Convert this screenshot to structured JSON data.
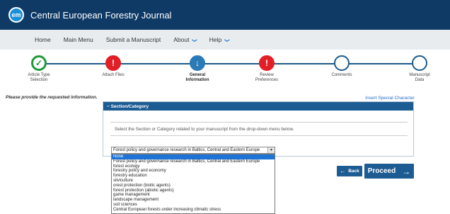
{
  "header": {
    "logo_text": "em",
    "journal_title": "Central European Forestry Journal"
  },
  "nav": {
    "home": "Home",
    "main_menu": "Main Menu",
    "submit": "Submit a Manuscript",
    "about": "About",
    "help": "Help",
    "caret": "❯"
  },
  "steps": [
    {
      "label": "Article Type Selection",
      "status": "complete",
      "icon": "check-icon",
      "symbol": "✓"
    },
    {
      "label": "Attach Files",
      "status": "error",
      "icon": "exclamation-icon",
      "symbol": "!"
    },
    {
      "label": "General Information",
      "status": "current",
      "icon": "arrow-down-icon",
      "symbol": "↓"
    },
    {
      "label": "Review Preferences",
      "status": "error",
      "icon": "exclamation-icon",
      "symbol": "!"
    },
    {
      "label": "Comments",
      "status": "pending",
      "icon": "empty-circle-icon",
      "symbol": ""
    },
    {
      "label": "Manuscript Data",
      "status": "pending",
      "icon": "empty-circle-icon",
      "symbol": ""
    }
  ],
  "content": {
    "instructions": "Please provide the requested information.",
    "special_char_link": "Insert Special Character",
    "panel_title": "− Section/Category",
    "panel_instruction": "Select the Section or Category related to your manuscript from the drop-down menu below.",
    "selected_value": "Forest policy and governance research in Baltics, Central and Eastern Europe",
    "options": [
      "None",
      "Forest policy and governance research in Baltics, Central and Eastern Europe",
      "forest ecology",
      "forestry policy and economy",
      "forestry education",
      "silviculture",
      "orest protection (biotic agents)",
      "forest protection (abiotic agents)",
      "game management",
      "landscape management",
      "soil sciences",
      "Central European forests under increasing climatic stress"
    ],
    "highlighted_option_index": 0,
    "back_label": "Back",
    "proceed_label": "Proceed",
    "back_arrow": "←",
    "proceed_arrow": "→"
  },
  "colors": {
    "header_bg": "#0f3a66",
    "accent": "#1d5b93",
    "error": "#e21e26",
    "success": "#1e9a3a",
    "background": "#f6f1d4"
  }
}
